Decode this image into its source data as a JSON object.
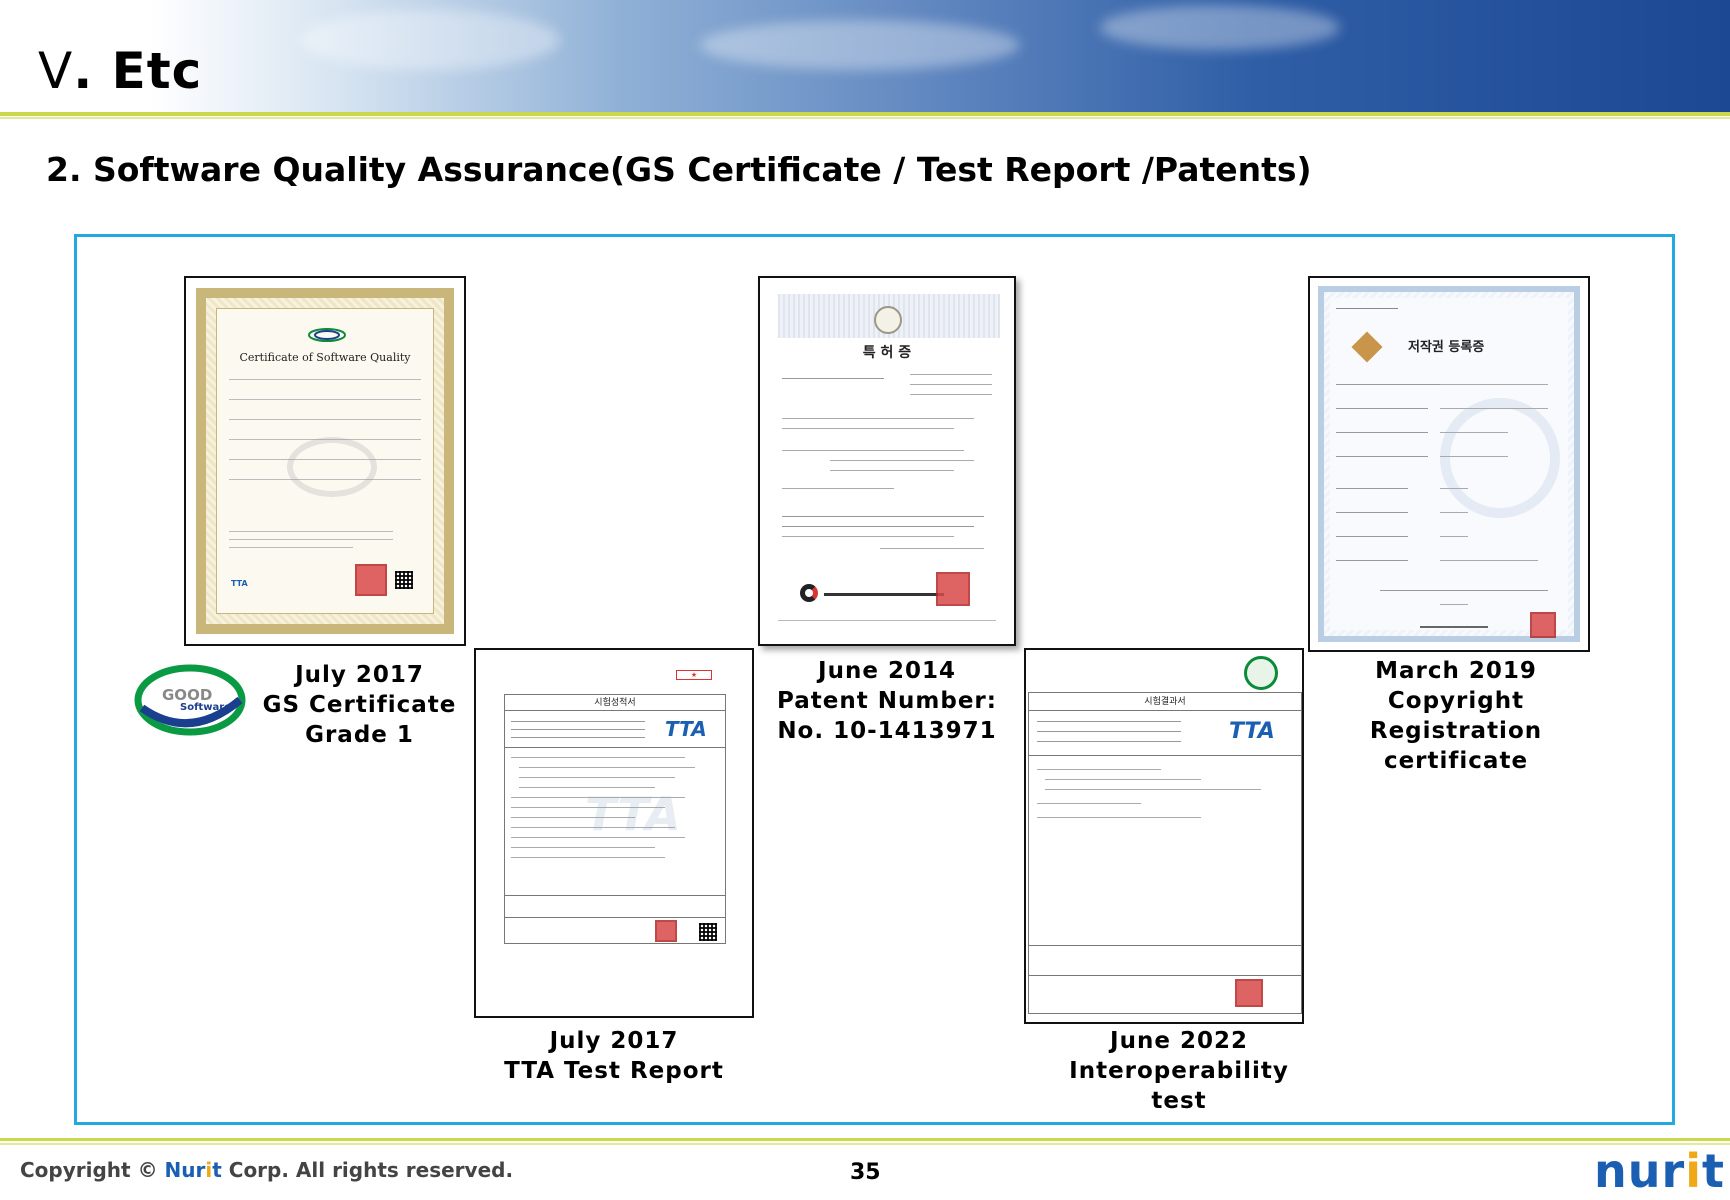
{
  "header": {
    "title_numeral": "Ⅴ",
    "title_text": ". Etc"
  },
  "section_title": "2. Software Quality Assurance(GS Certificate / Test Report /Patents)",
  "documents": [
    {
      "id": "gs-certificate",
      "heading": "Certificate of Software Quality",
      "caption": [
        "July 2017",
        "GS Certificate",
        "Grade 1"
      ]
    },
    {
      "id": "tta-test-report",
      "heading": "시험성적서",
      "caption": [
        "July 2017",
        "TTA Test Report"
      ]
    },
    {
      "id": "patent",
      "heading": "특 허 증",
      "caption": [
        "June 2014",
        "Patent Number:",
        "No. 10-1413971"
      ]
    },
    {
      "id": "interoperability",
      "heading": "시험결과서",
      "caption": [
        "June 2022",
        "Interoperability",
        "test"
      ]
    },
    {
      "id": "copyright",
      "heading": "저작권 등록증",
      "caption": [
        "March 2019",
        "Copyright",
        "Registration",
        "certificate"
      ]
    }
  ],
  "good_software_logo": {
    "line1": "GOOD",
    "line2": "Software"
  },
  "footer": {
    "copyright_prefix": "Copyright © ",
    "brand_a": "Nur",
    "brand_b": "i",
    "brand_c": "t",
    "copyright_suffix": " Corp. All rights reserved.",
    "page_number": "35",
    "logo_a": "nur",
    "logo_b": "i",
    "logo_c": "t"
  },
  "colors": {
    "frame": "#22a9e1",
    "accent_line": "#c9d94b",
    "brand_blue": "#1b5fb3",
    "brand_orange": "#f0a818"
  }
}
